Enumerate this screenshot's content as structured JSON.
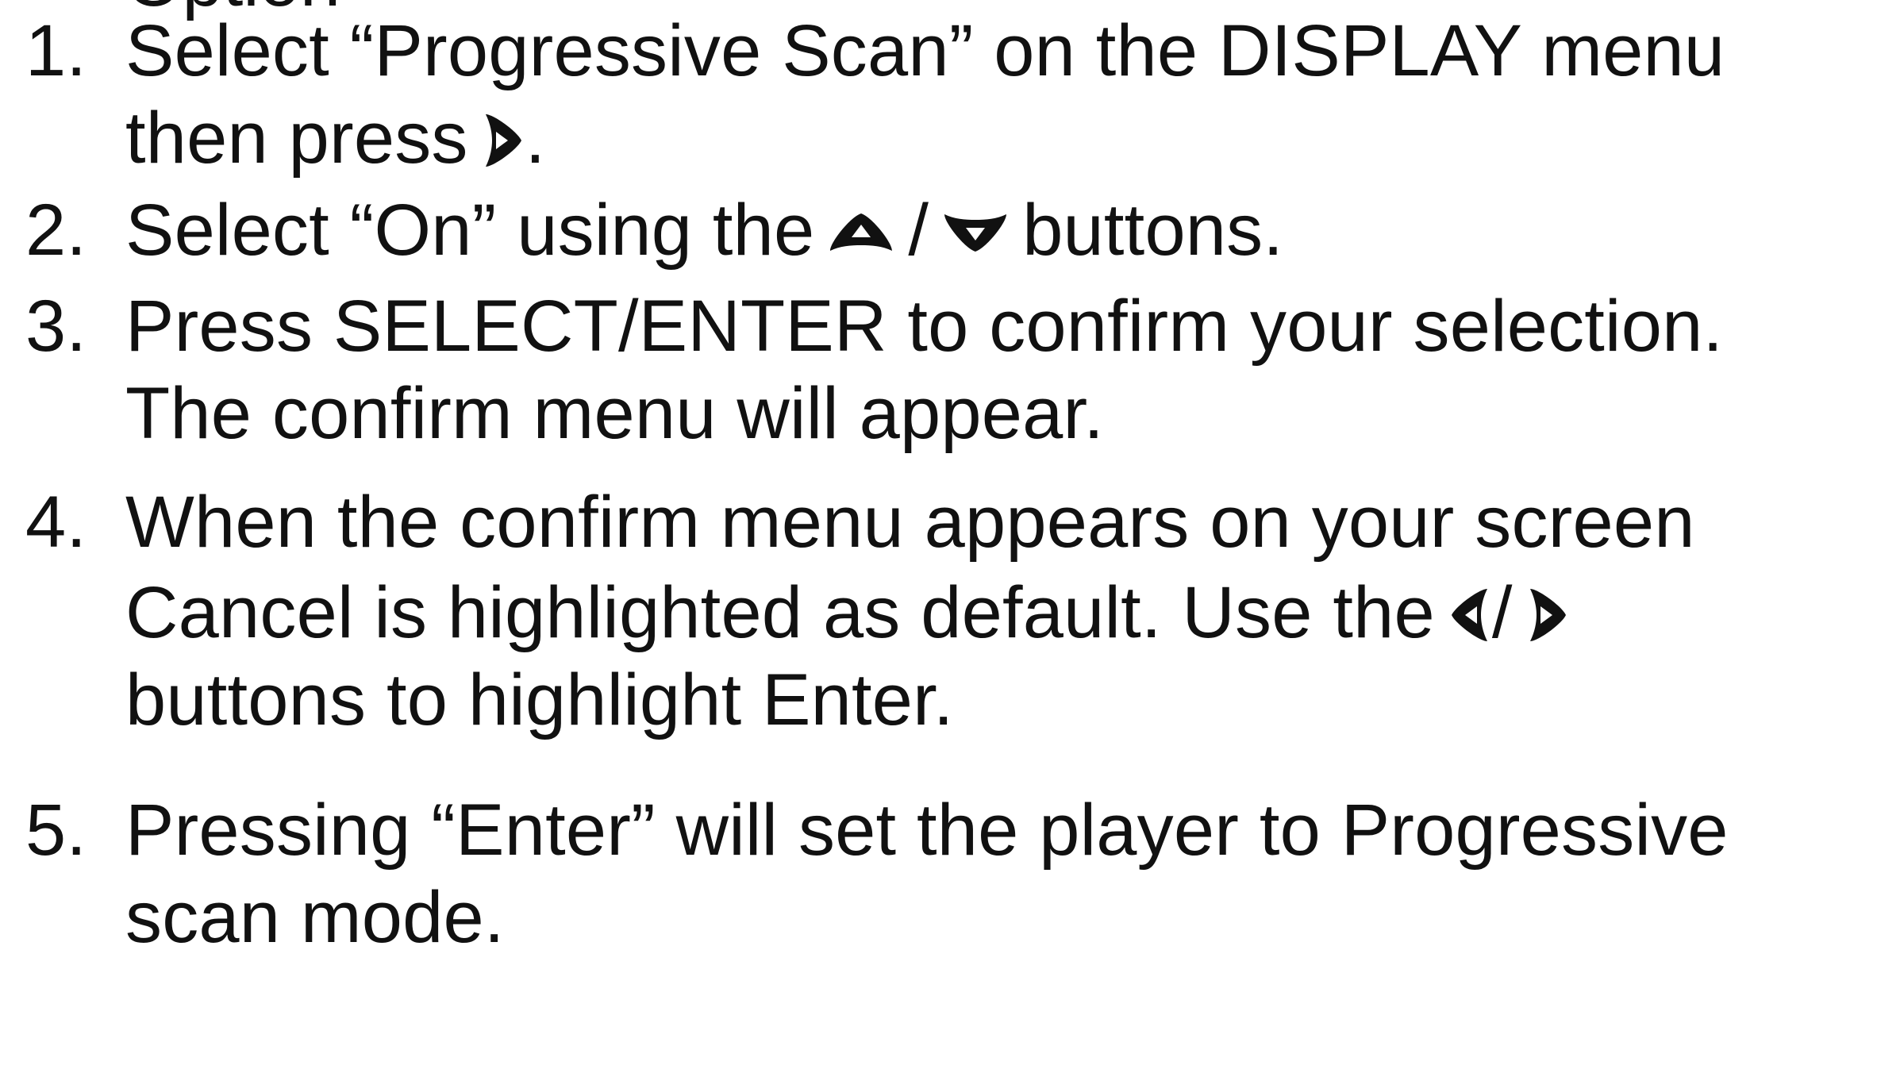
{
  "cut_header": "Option",
  "steps": [
    {
      "number": "1.",
      "lines": [
        "Select “Progressive Scan” on the DISPLAY menu",
        "then press",
        "."
      ]
    },
    {
      "number": "2.",
      "lines": [
        "Select “On” using the",
        "/",
        "buttons."
      ]
    },
    {
      "number": "3.",
      "lines": [
        "Press SELECT/ENTER to confirm your selection.",
        "The confirm menu will appear."
      ]
    },
    {
      "number": "4.",
      "lines": [
        "When the confirm menu appears on your screen",
        "Cancel is highlighted as default. Use the",
        "/",
        "buttons to highlight Enter."
      ]
    },
    {
      "number": "5.",
      "lines": [
        "Pressing “Enter” will set the player to Progressive",
        "scan mode."
      ]
    }
  ],
  "icons": {
    "right": "right-arrow-icon",
    "up": "up-arrow-icon",
    "down": "down-arrow-icon",
    "left": "left-arrow-icon"
  },
  "colors": {
    "text": "#111111",
    "background": "#ffffff"
  }
}
